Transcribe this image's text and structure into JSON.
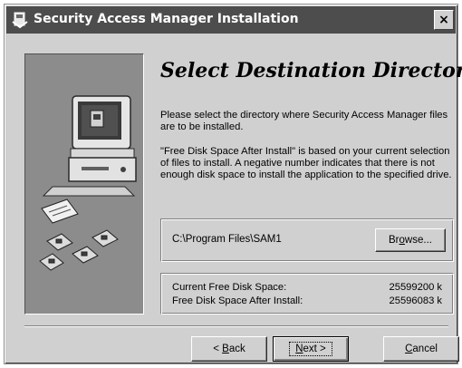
{
  "window": {
    "title": "Security Access Manager Installation",
    "close_glyph": "×"
  },
  "page": {
    "heading": "Select Destination Directory",
    "paragraph1": "Please select the directory where Security Access Manager files are to be installed.",
    "paragraph2": "\"Free Disk Space After Install\" is based on your current selection of files to install.  A negative number indicates that there is not enough disk space to install the application to the specified drive."
  },
  "destination": {
    "path": "C:\\Program Files\\SAM1",
    "browse_label_pre": "Br",
    "browse_label_acc": "o",
    "browse_label_post": "wse..."
  },
  "disk_space": {
    "current_label": "Current Free Disk Space:",
    "current_value": "25599200 k",
    "after_label": "Free Disk Space After Install:",
    "after_value": "25596083 k"
  },
  "buttons": {
    "back_pre": "< ",
    "back_acc": "B",
    "back_post": "ack",
    "next_acc": "N",
    "next_post": "ext >",
    "cancel_acc": "C",
    "cancel_post": "ancel"
  },
  "icons": {
    "title_icon": "installer-icon",
    "side_art": "computer-with-disks-illustration"
  },
  "colors": {
    "dialog_face": "#d4d0c8",
    "titlebar": "#4d4d4d",
    "side_panel": "#8c8c8c"
  }
}
